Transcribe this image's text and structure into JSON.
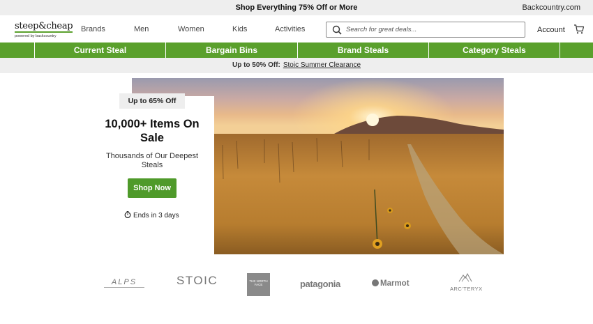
{
  "topbar": {
    "promo": "Shop Everything 75% Off or More",
    "backcountry": "Backcountry.com"
  },
  "logo": {
    "name": "steep&cheap",
    "tagline": "powered by backcountry"
  },
  "nav": [
    "Brands",
    "Men",
    "Women",
    "Kids",
    "Activities"
  ],
  "search": {
    "placeholder": "Search for great deals...",
    "icon": "search-icon"
  },
  "account": {
    "label": "Account",
    "cart_icon": "cart-icon"
  },
  "green_nav": [
    "Current Steal",
    "Bargain Bins",
    "Brand Steals",
    "Category Steals"
  ],
  "sale_band": {
    "lead": "Up to 50% Off:",
    "link": "Stoic Summer Clearance"
  },
  "hero": {
    "badge": "Up to 65% Off",
    "title": "10,000+ Items On Sale",
    "subtitle": "Thousands of Our Deepest Steals",
    "cta": "Shop Now",
    "ends": "Ends in 3 days"
  },
  "brands": [
    "ALPS",
    "STOIC",
    "THE NORTH FACE",
    "patagonia",
    "Marmot",
    "ARC'TERYX"
  ],
  "colors": {
    "accent_green": "#5aa02c",
    "band_gray": "#eeeeee"
  }
}
